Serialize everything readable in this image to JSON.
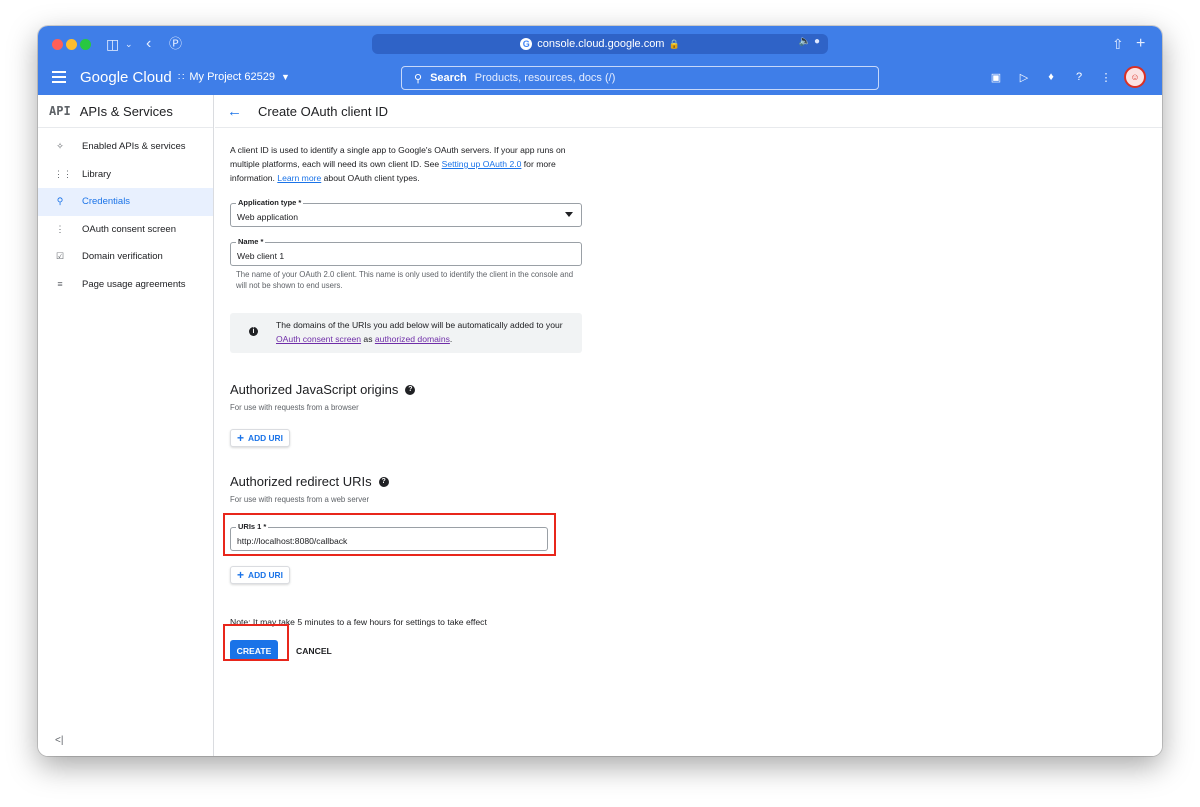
{
  "browser": {
    "url": "console.cloud.google.com",
    "favicon_letter": "G"
  },
  "header": {
    "brand": "Google Cloud",
    "project": "My Project 62529",
    "search_label": "Search",
    "search_placeholder": "Products, resources, docs (/)"
  },
  "sidebar": {
    "api_badge": "API",
    "title": "APIs & Services",
    "items": [
      {
        "label": "Enabled APIs & services",
        "icon": "endpoints-icon"
      },
      {
        "label": "Library",
        "icon": "library-icon"
      },
      {
        "label": "Credentials",
        "icon": "key-icon",
        "active": true
      },
      {
        "label": "OAuth consent screen",
        "icon": "consent-icon"
      },
      {
        "label": "Domain verification",
        "icon": "domain-checkbox-icon"
      },
      {
        "label": "Page usage agreements",
        "icon": "settings-list-icon"
      }
    ],
    "collapse_label": "<|"
  },
  "page": {
    "title": "Create OAuth client ID",
    "intro_1": "A client ID is used to identify a single app to Google's OAuth servers. If your app runs on multiple platforms, each will need its own client ID. See",
    "intro_link_1": "Setting up OAuth 2.0",
    "intro_2": "for more information.",
    "intro_link_2": "Learn more",
    "intro_3": "about OAuth client types.",
    "application_type": {
      "label": "Application type *",
      "value": "Web application"
    },
    "name_field": {
      "label": "Name *",
      "value": "Web client 1"
    },
    "name_helper": "The name of your OAuth 2.0 client. This name is only used to identify the client in the console and will not be shown to end users.",
    "info": {
      "text_1": "The domains of the URIs you add below will be automatically added to your",
      "link_1": "OAuth consent screen",
      "text_2": "as",
      "link_2": "authorized domains",
      "text_3": "."
    },
    "js_origins": {
      "title": "Authorized JavaScript origins",
      "subtitle": "For use with requests from a browser",
      "add_label": "ADD URI"
    },
    "redirect_uris": {
      "title": "Authorized redirect URIs",
      "subtitle": "For use with requests from a web server",
      "uri_label": "URIs 1 *",
      "uri_value": "http://localhost:8080/callback",
      "add_label": "ADD URI"
    },
    "note": "Note: It may take 5 minutes to a few hours for settings to take effect",
    "create_label": "CREATE",
    "cancel_label": "CANCEL"
  },
  "colors": {
    "brand_blue": "#3f7ee8",
    "link_blue": "#1a73e8",
    "highlight_red": "#e8261b"
  }
}
